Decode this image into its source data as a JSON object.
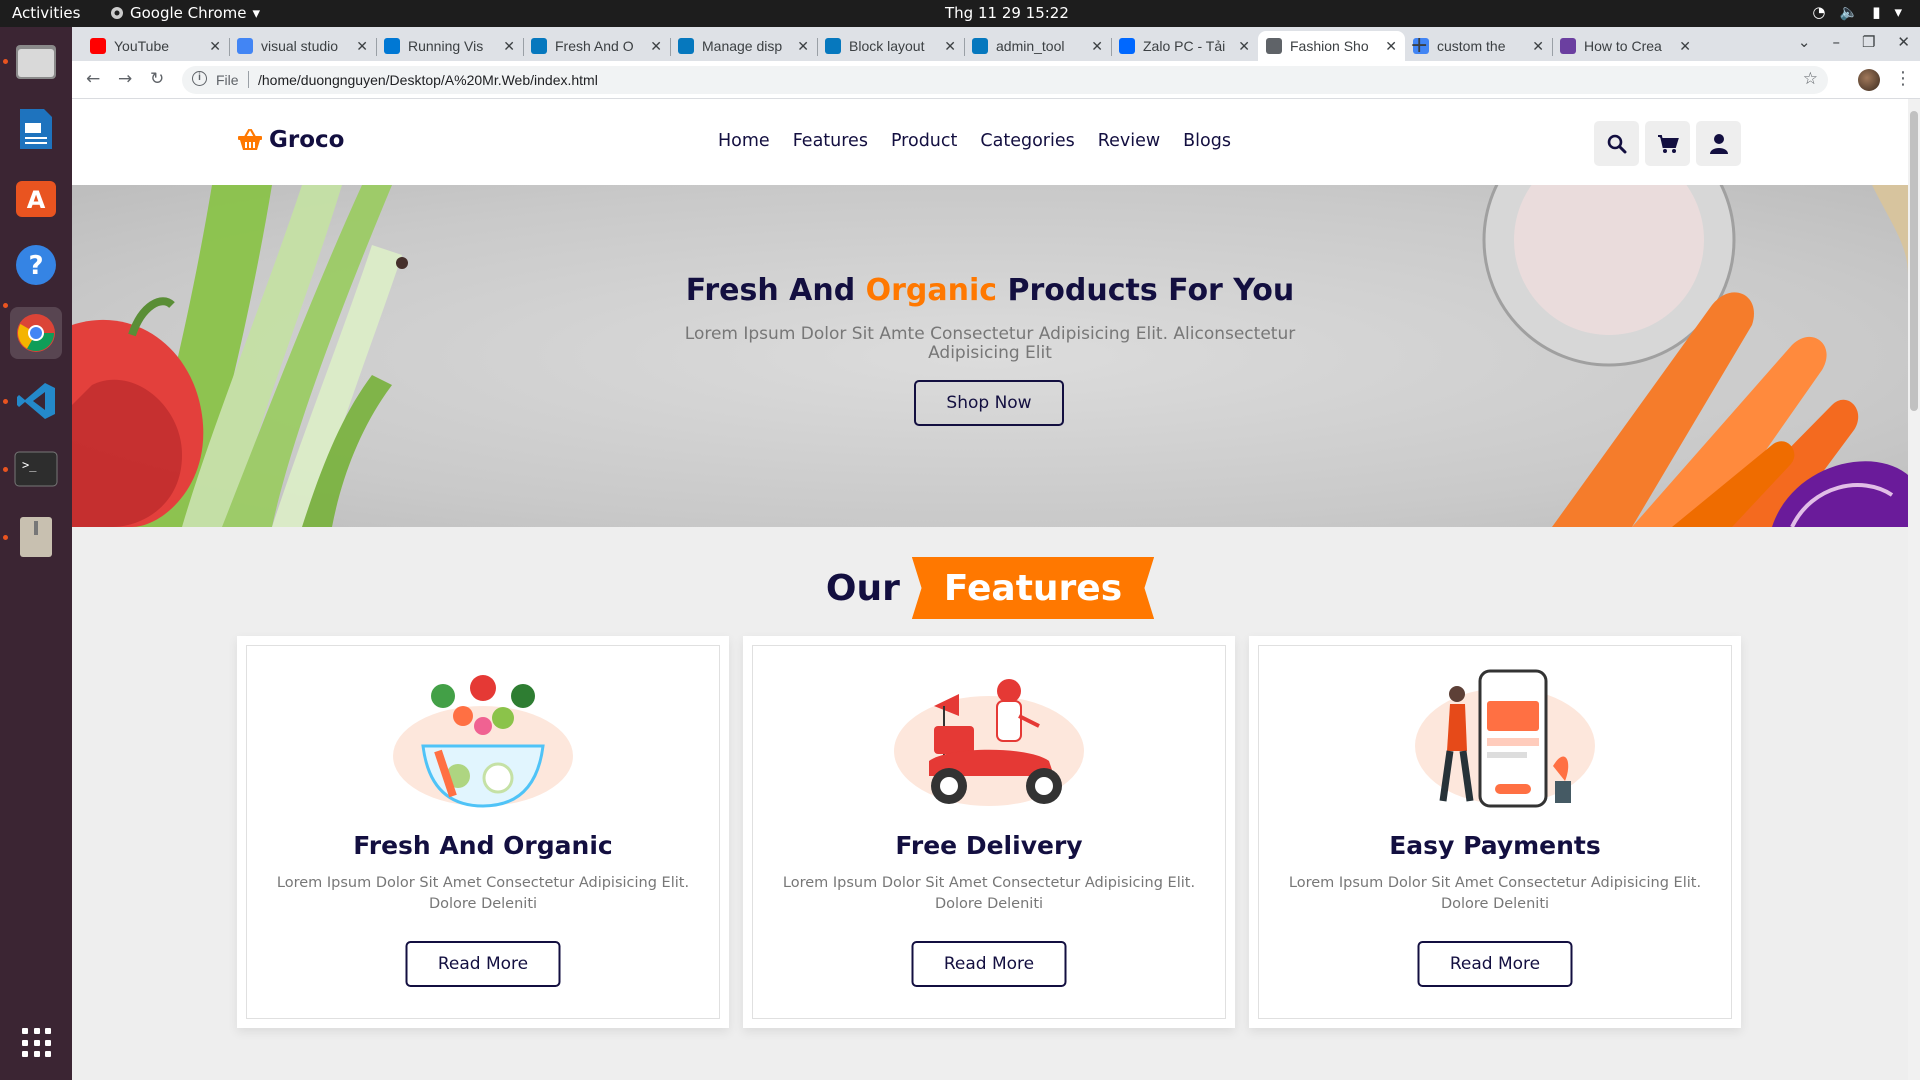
{
  "os": {
    "activities": "Activities",
    "app_menu": "Google Chrome",
    "clock": "Thg 11 29  15:22"
  },
  "browser": {
    "tabs": [
      {
        "title": "YouTube",
        "favicon": "youtube-icon",
        "color": "#ff0000"
      },
      {
        "title": "visual studio",
        "favicon": "google-icon",
        "color": "#4285f4"
      },
      {
        "title": "Running Vis",
        "favicon": "vscode-icon",
        "color": "#0078d4"
      },
      {
        "title": "Fresh And O",
        "favicon": "drupal-icon",
        "color": "#0678be"
      },
      {
        "title": "Manage disp",
        "favicon": "drupal-icon",
        "color": "#0678be"
      },
      {
        "title": "Block layout",
        "favicon": "drupal-icon",
        "color": "#0678be"
      },
      {
        "title": "admin_tool",
        "favicon": "drupal-drop-icon",
        "color": "#0678be"
      },
      {
        "title": "Zalo PC - Tải",
        "favicon": "zalo-icon",
        "color": "#0068ff"
      },
      {
        "title": "Fashion Sho",
        "favicon": "globe-icon",
        "color": "#5f6368"
      },
      {
        "title": "custom the",
        "favicon": "google-icon",
        "color": "#4285f4"
      },
      {
        "title": "How to Crea",
        "favicon": "tt-icon",
        "color": "#6b3fa0"
      }
    ],
    "active_tab_index": 8,
    "omnibox": {
      "scheme": "File",
      "url": "/home/duongnguyen/Desktop/A%20Mr.Web/index.html"
    }
  },
  "site": {
    "brand": "Groco",
    "nav": [
      "Home",
      "Features",
      "Product",
      "Categories",
      "Review",
      "Blogs"
    ],
    "hero": {
      "title_before": "Fresh And ",
      "title_accent": "Organic",
      "title_after": " Products For You",
      "subtitle": "Lorem Ipsum Dolor Sit Amte Consectetur Adipisicing Elit. Aliconsectetur Adipisicing Elit",
      "cta": "Shop Now"
    },
    "features_heading": {
      "our": "Our",
      "highlight": "Features"
    },
    "features": [
      {
        "title": "Fresh And Organic",
        "text": "Lorem Ipsum Dolor Sit Amet Consectetur Adipisicing Elit. Dolore Deleniti",
        "cta": "Read More"
      },
      {
        "title": "Free Delivery",
        "text": "Lorem Ipsum Dolor Sit Amet Consectetur Adipisicing Elit. Dolore Deleniti",
        "cta": "Read More"
      },
      {
        "title": "Easy Payments",
        "text": "Lorem Ipsum Dolor Sit Amet Consectetur Adipisicing Elit. Dolore Deleniti",
        "cta": "Read More"
      }
    ],
    "colors": {
      "primary": "#130f40",
      "accent": "#ff7800",
      "light_bg": "#eeeeee"
    }
  }
}
